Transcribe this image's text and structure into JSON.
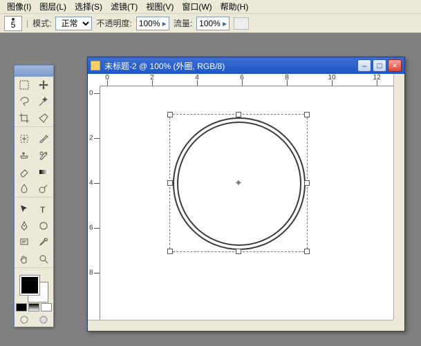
{
  "menu": {
    "image": "图像(I)",
    "layer": "图层(L)",
    "select": "选择(S)",
    "filter": "滤镜(T)",
    "view": "视图(V)",
    "window": "窗口(W)",
    "help": "帮助(H)"
  },
  "options": {
    "brush_size": "5",
    "mode_label": "模式:",
    "mode_value": "正常",
    "opacity_label": "不透明度:",
    "opacity_value": "100%",
    "flow_label": "流量:",
    "flow_value": "100%"
  },
  "tools": {
    "marquee": "marquee",
    "move": "move",
    "lasso": "lasso",
    "wand": "wand",
    "crop": "crop",
    "slice": "slice",
    "heal": "heal",
    "brush": "brush",
    "stamp": "stamp",
    "history": "history",
    "eraser": "eraser",
    "gradient": "gradient",
    "blur": "blur",
    "dodge": "dodge",
    "path": "path",
    "type": "type",
    "pen": "pen",
    "shape": "shape",
    "notes": "notes",
    "eyedrop": "eyedrop",
    "hand": "hand",
    "zoom": "zoom"
  },
  "swatch": {
    "fg": "#000000",
    "bg": "#ffffff"
  },
  "doc": {
    "title": "未标题-2 @ 100% (外圈, RGB/8)",
    "ruler_h": [
      "0",
      "2",
      "4",
      "6",
      "8",
      "10",
      "12"
    ],
    "ruler_v": [
      "0",
      "2",
      "4",
      "6",
      "8"
    ]
  },
  "winbtn": {
    "min": "–",
    "max": "□",
    "close": "×"
  }
}
